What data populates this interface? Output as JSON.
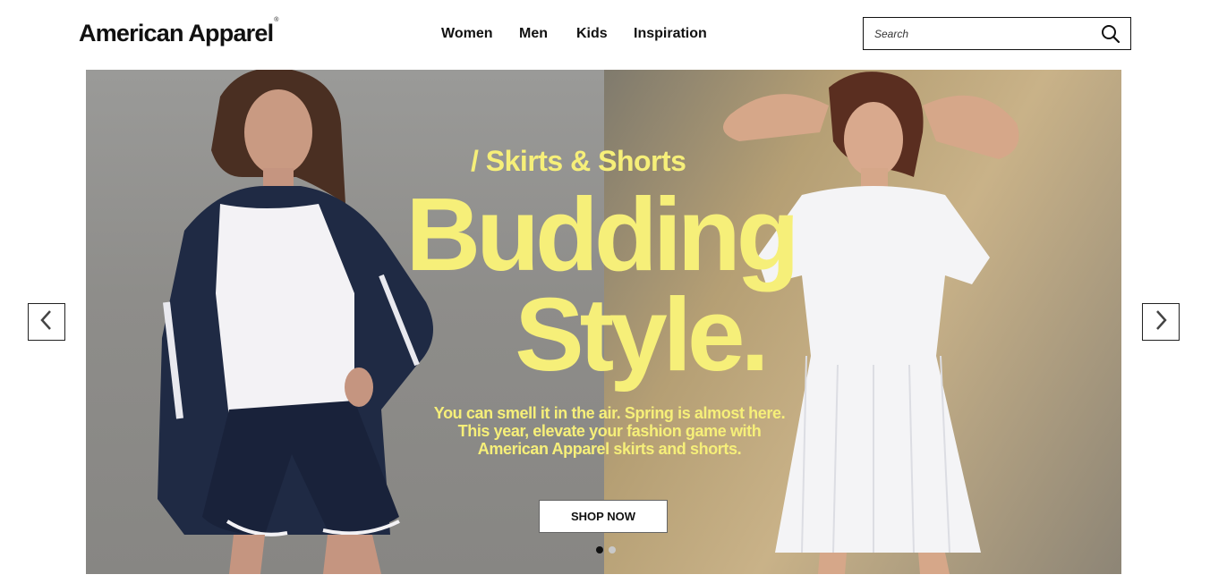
{
  "header": {
    "logo_text": "American Apparel",
    "logo_mark": "®",
    "nav": [
      "Women",
      "Men",
      "Kids",
      "Inspiration"
    ],
    "search": {
      "placeholder": "Search",
      "icon": "search-icon"
    }
  },
  "hero": {
    "kicker": "/ Skirts & Shorts",
    "headline_line1": "Budding",
    "headline_line2": "Style.",
    "body_line1": "You can smell it in the air. Spring is almost here.",
    "body_line2": "This year, elevate your fashion game with",
    "body_line3": "American Apparel skirts and shorts.",
    "cta_label": "SHOP NOW",
    "slide_count": 2,
    "active_slide": 1,
    "accent_color": "#f6ef79",
    "prev_icon": "chevron-left-icon",
    "next_icon": "chevron-right-icon"
  }
}
